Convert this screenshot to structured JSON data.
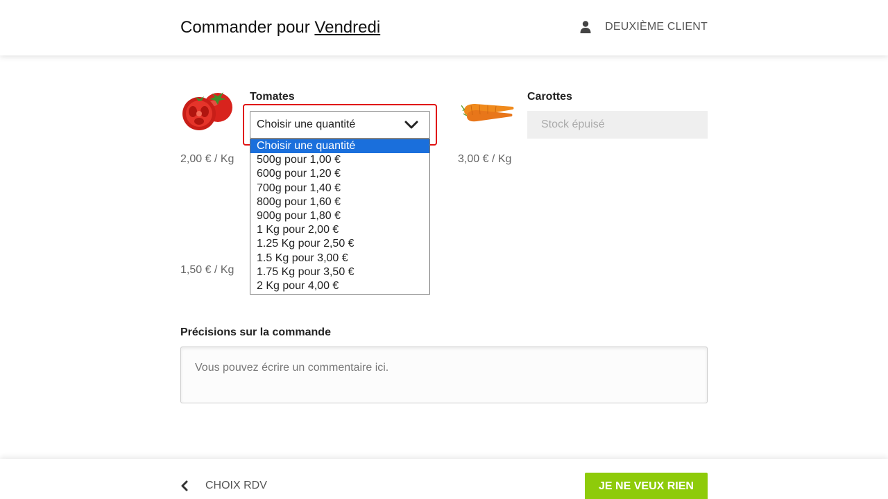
{
  "header": {
    "title_prefix": "Commander pour",
    "day": "Vendredi",
    "user_icon": "user-icon",
    "user_name": "DEUXIÈME CLIENT"
  },
  "products": [
    {
      "name": "Tomates",
      "image": "tomato-image",
      "price": "2,00 € / Kg",
      "select": {
        "value": "Choisir une quantité",
        "options": [
          "Choisir une quantité",
          "500g pour 1,00 €",
          "600g pour 1,20 €",
          "700g pour 1,40 €",
          "800g pour 1,60 €",
          "900g pour 1,80 €",
          "1 Kg pour 2,00 €",
          "1.25 Kg pour 2,50 €",
          "1.5 Kg pour 3,00 €",
          "1.75 Kg pour 3,50 €",
          "2 Kg pour 4,00 €"
        ]
      }
    },
    {
      "name": "Carottes",
      "image": "carrot-image",
      "price": "3,00 € / Kg",
      "stock_status": "Stock épuisé"
    },
    {
      "price": "1,50 € / Kg"
    }
  ],
  "notes": {
    "label": "Précisions sur la commande",
    "placeholder": "Vous pouvez écrire un commentaire ici."
  },
  "footer": {
    "back_label": "CHOIX RDV",
    "no_thanks_label": "JE NE VEUX RIEN"
  },
  "colors": {
    "accent_green": "#8ecb0a",
    "highlight_red": "#e01010",
    "option_selected": "#1a6fdc"
  }
}
